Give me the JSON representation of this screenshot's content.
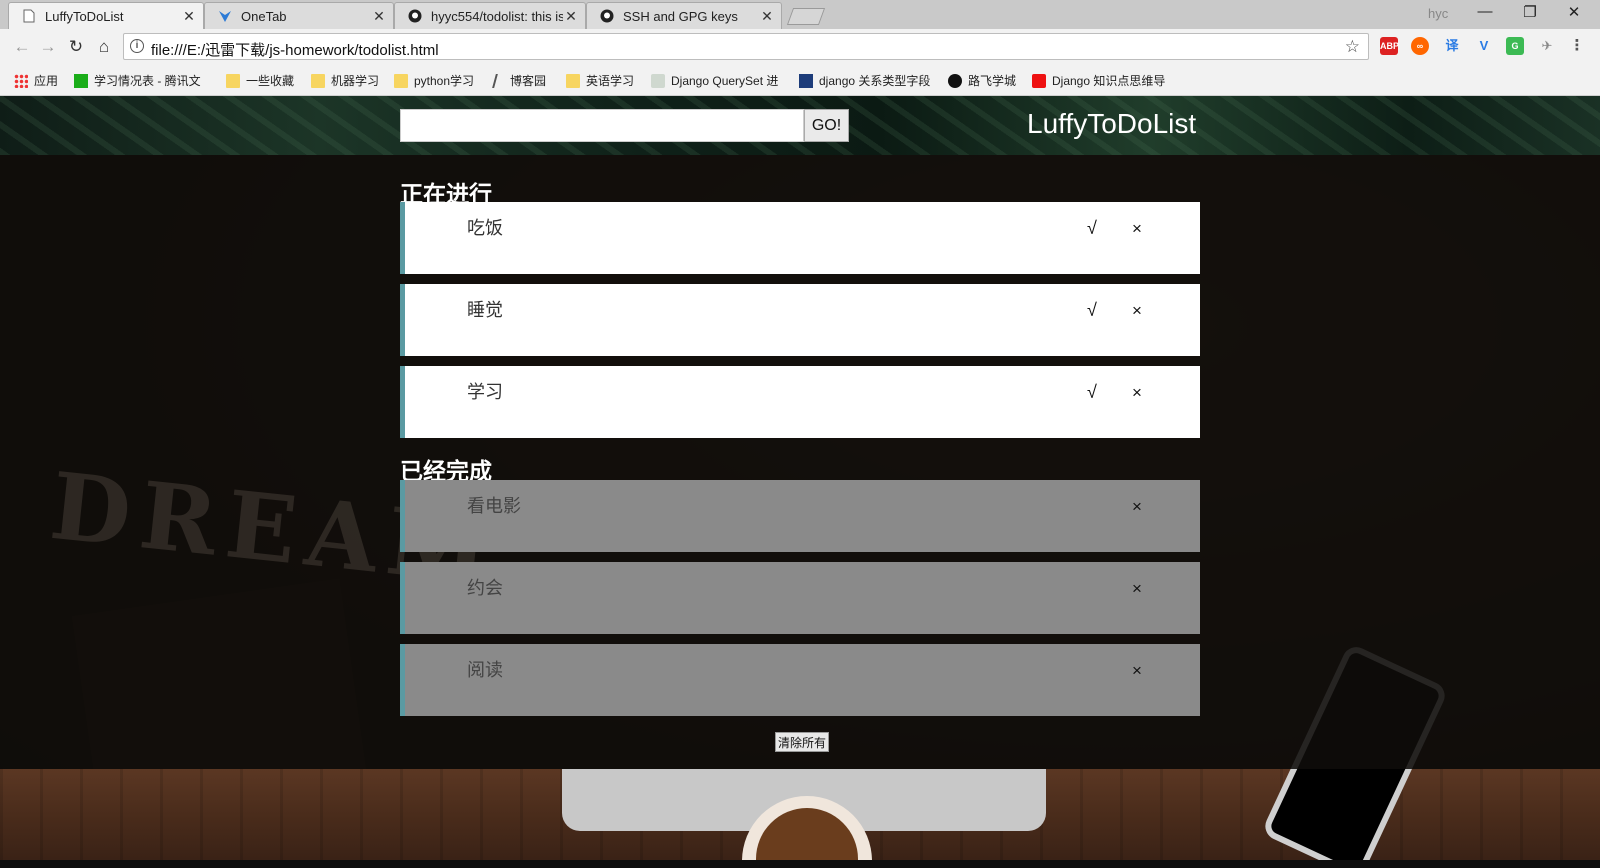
{
  "browser": {
    "tabs": [
      {
        "title": "LuffyToDoList",
        "icon": "page-icon",
        "active": true
      },
      {
        "title": "OneTab",
        "icon": "onetab-icon",
        "active": false
      },
      {
        "title": "hyyc554/todolist: this is",
        "icon": "github-icon",
        "active": false
      },
      {
        "title": "SSH and GPG keys",
        "icon": "github-icon",
        "active": false
      }
    ],
    "close_glyph": "✕",
    "profile_name": "hyc",
    "window_controls": [
      "—",
      "❐",
      "✕"
    ],
    "url": "file:///E:/迅雷下载/js-homework/todolist.html",
    "extensions": [
      "ABP",
      "∞",
      "译",
      "V",
      "G",
      "✈",
      "⋮"
    ],
    "bookmarks": [
      {
        "label": "应用",
        "icon": "apps-icon"
      },
      {
        "label": "学习情况表 - 腾讯文",
        "icon": "sheet-icon"
      },
      {
        "label": "一些收藏",
        "icon": "folder-icon"
      },
      {
        "label": "机器学习",
        "icon": "folder-icon"
      },
      {
        "label": "python学习",
        "icon": "folder-icon"
      },
      {
        "label": "博客园",
        "icon": "cnblogs-icon"
      },
      {
        "label": "英语学习",
        "icon": "folder-icon"
      },
      {
        "label": "Django QuerySet 进",
        "icon": "django-icon"
      },
      {
        "label": "django 关系类型字段",
        "icon": "lj-icon"
      },
      {
        "label": "路飞学城",
        "icon": "luffy-icon"
      },
      {
        "label": "Django 知识点思维导",
        "icon": "csdn-icon"
      }
    ]
  },
  "app": {
    "brand": "LuffyToDoList",
    "search": {
      "value": "",
      "button_label": "GO!"
    },
    "doing_title": "正在进行",
    "done_title": "已经完成",
    "doing_items": [
      "吃饭",
      "睡觉",
      "学习"
    ],
    "done_items": [
      "看电影",
      "约会",
      "阅读"
    ],
    "check_glyph": "√",
    "delete_glyph": "×",
    "clear_label": "清除所有",
    "background_text": "DREAM"
  },
  "colors": {
    "accent_border": "#5a9aa2",
    "doing_bg": "#ffffff",
    "done_bg": "#8a8a8a"
  }
}
